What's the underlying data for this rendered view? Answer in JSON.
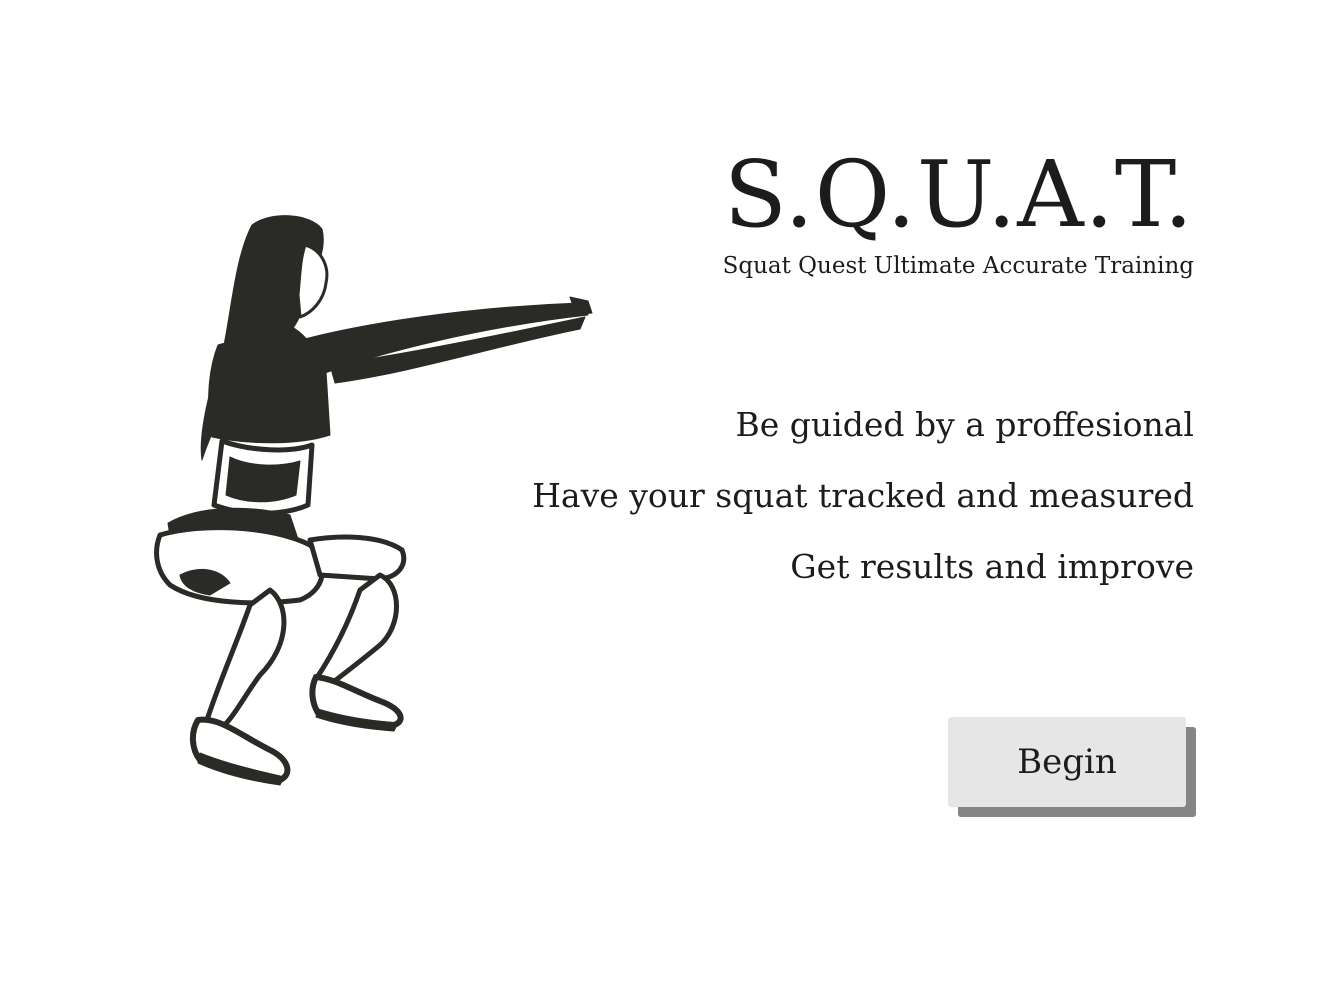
{
  "brand": {
    "title": "S.Q.U.A.T.",
    "subtitle": "Squat Quest Ultimate Accurate Training"
  },
  "features": [
    "Be guided by a proffesional",
    "Have your squat tracked and measured",
    "Get results and improve"
  ],
  "actions": {
    "begin_label": "Begin"
  },
  "colors": {
    "background": "#ffffff",
    "text": "#1c1c1a",
    "button_face": "#e6e6e6",
    "button_shadow": "#858585"
  }
}
